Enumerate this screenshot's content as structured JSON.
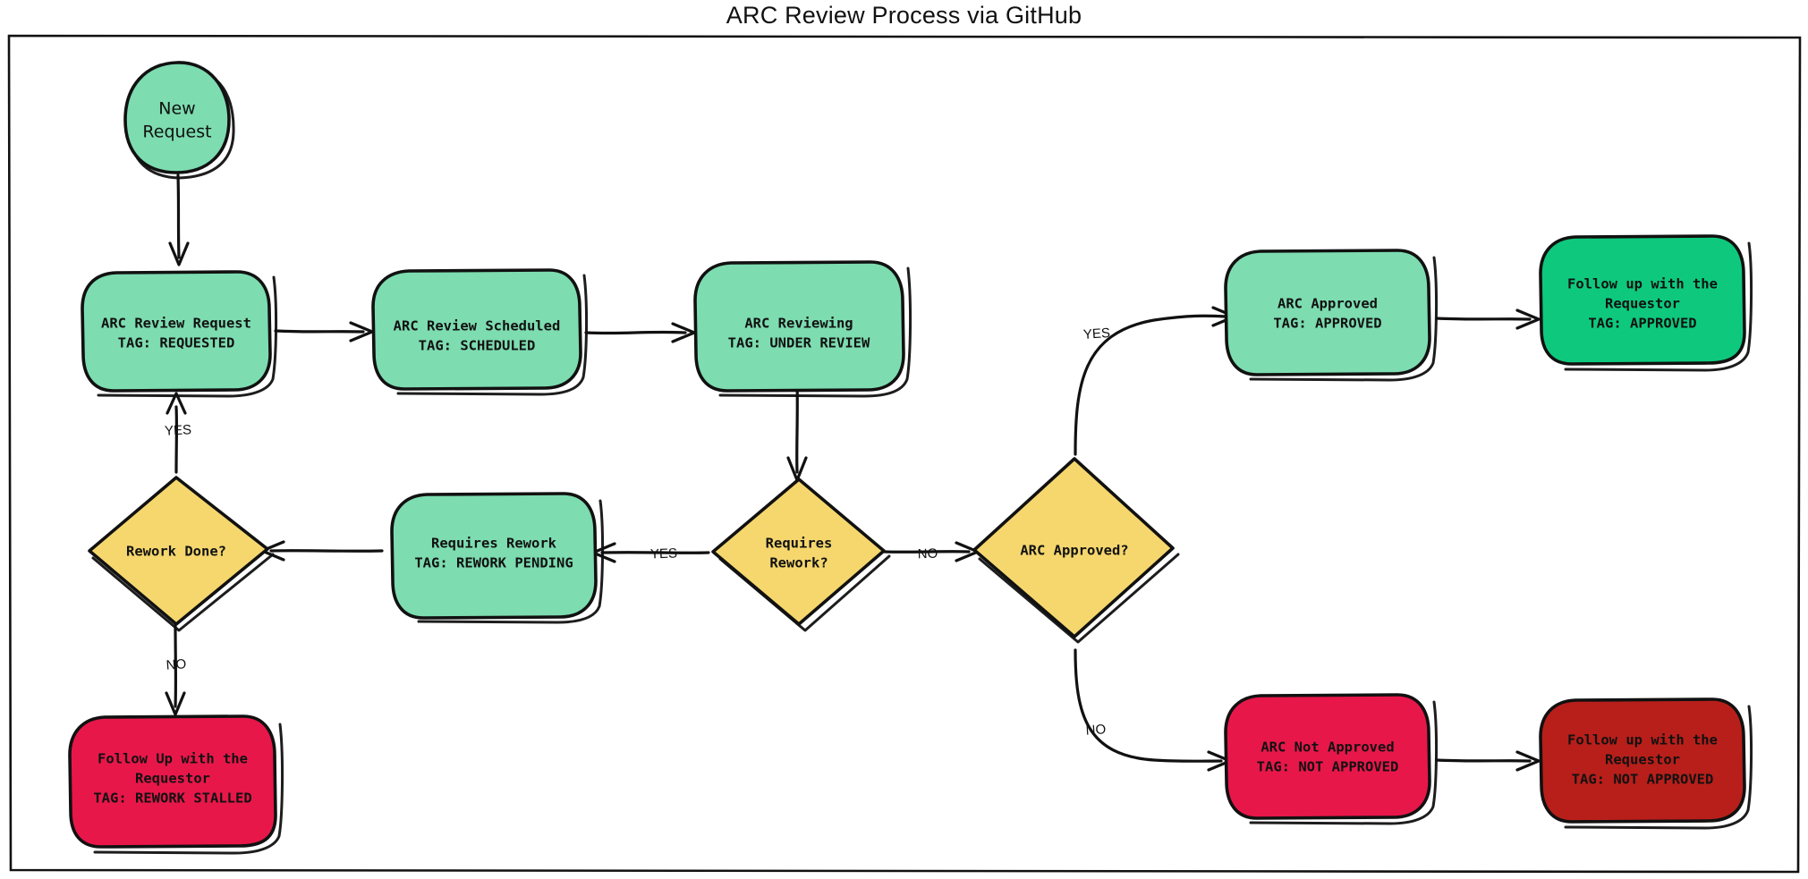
{
  "title": "ARC Review Process via GitHub",
  "theme": {
    "background": "#ffffff",
    "stroke": "#111111",
    "green": "#7ddcb0",
    "bright_green": "#0ec97d",
    "yellow": "#f5d76e",
    "crimson": "#e8174a",
    "dark_red": "#b81f1a"
  },
  "nodes": {
    "start": {
      "label": "New\nRequest",
      "shape": "circle",
      "color": "#7ddcb0"
    },
    "requested": {
      "line1": "ARC Review Request",
      "line2": "TAG: REQUESTED",
      "shape": "rounded-rect",
      "color": "#7ddcb0"
    },
    "scheduled": {
      "line1": "ARC Review Scheduled",
      "line2": "TAG: SCHEDULED",
      "shape": "rounded-rect",
      "color": "#7ddcb0"
    },
    "reviewing": {
      "line1": "ARC Reviewing",
      "line2": "TAG: UNDER REVIEW",
      "shape": "rounded-rect",
      "color": "#7ddcb0"
    },
    "requires_rework_decision": {
      "line1": "Requires",
      "line2": "Rework?",
      "shape": "diamond",
      "color": "#f5d76e"
    },
    "requires_rework_state": {
      "line1": "Requires Rework",
      "line2": "TAG: REWORK PENDING",
      "shape": "rounded-rect",
      "color": "#7ddcb0"
    },
    "rework_done_decision": {
      "line1": "Rework Done?",
      "line2": "",
      "shape": "diamond",
      "color": "#f5d76e"
    },
    "rework_stalled": {
      "line1": "Follow Up with the",
      "line2": "Requestor",
      "line3": "TAG: REWORK STALLED",
      "shape": "rounded-rect",
      "color": "#e8174a"
    },
    "arc_approved_decision": {
      "line1": "ARC Approved?",
      "line2": "",
      "shape": "diamond",
      "color": "#f5d76e"
    },
    "arc_approved": {
      "line1": "ARC Approved",
      "line2": "TAG: APPROVED",
      "shape": "rounded-rect",
      "color": "#7ddcb0"
    },
    "followup_approved": {
      "line1": "Follow up with the",
      "line2": "Requestor",
      "line3": "TAG: APPROVED",
      "shape": "rounded-rect",
      "color": "#0ec97d"
    },
    "arc_not_approved": {
      "line1": "ARC Not Approved",
      "line2": "TAG: NOT APPROVED",
      "shape": "rounded-rect",
      "color": "#e8174a"
    },
    "followup_not_approved": {
      "line1": "Follow up with the",
      "line2": "Requestor",
      "line3": "TAG: NOT APPROVED",
      "shape": "rounded-rect",
      "color": "#b81f1a"
    }
  },
  "edge_labels": {
    "rework_done_yes": "YES",
    "rework_done_no": "NO",
    "requires_rework_yes": "YES",
    "requires_rework_no": "NO",
    "arc_approved_yes": "YES",
    "arc_approved_no": "NO"
  }
}
